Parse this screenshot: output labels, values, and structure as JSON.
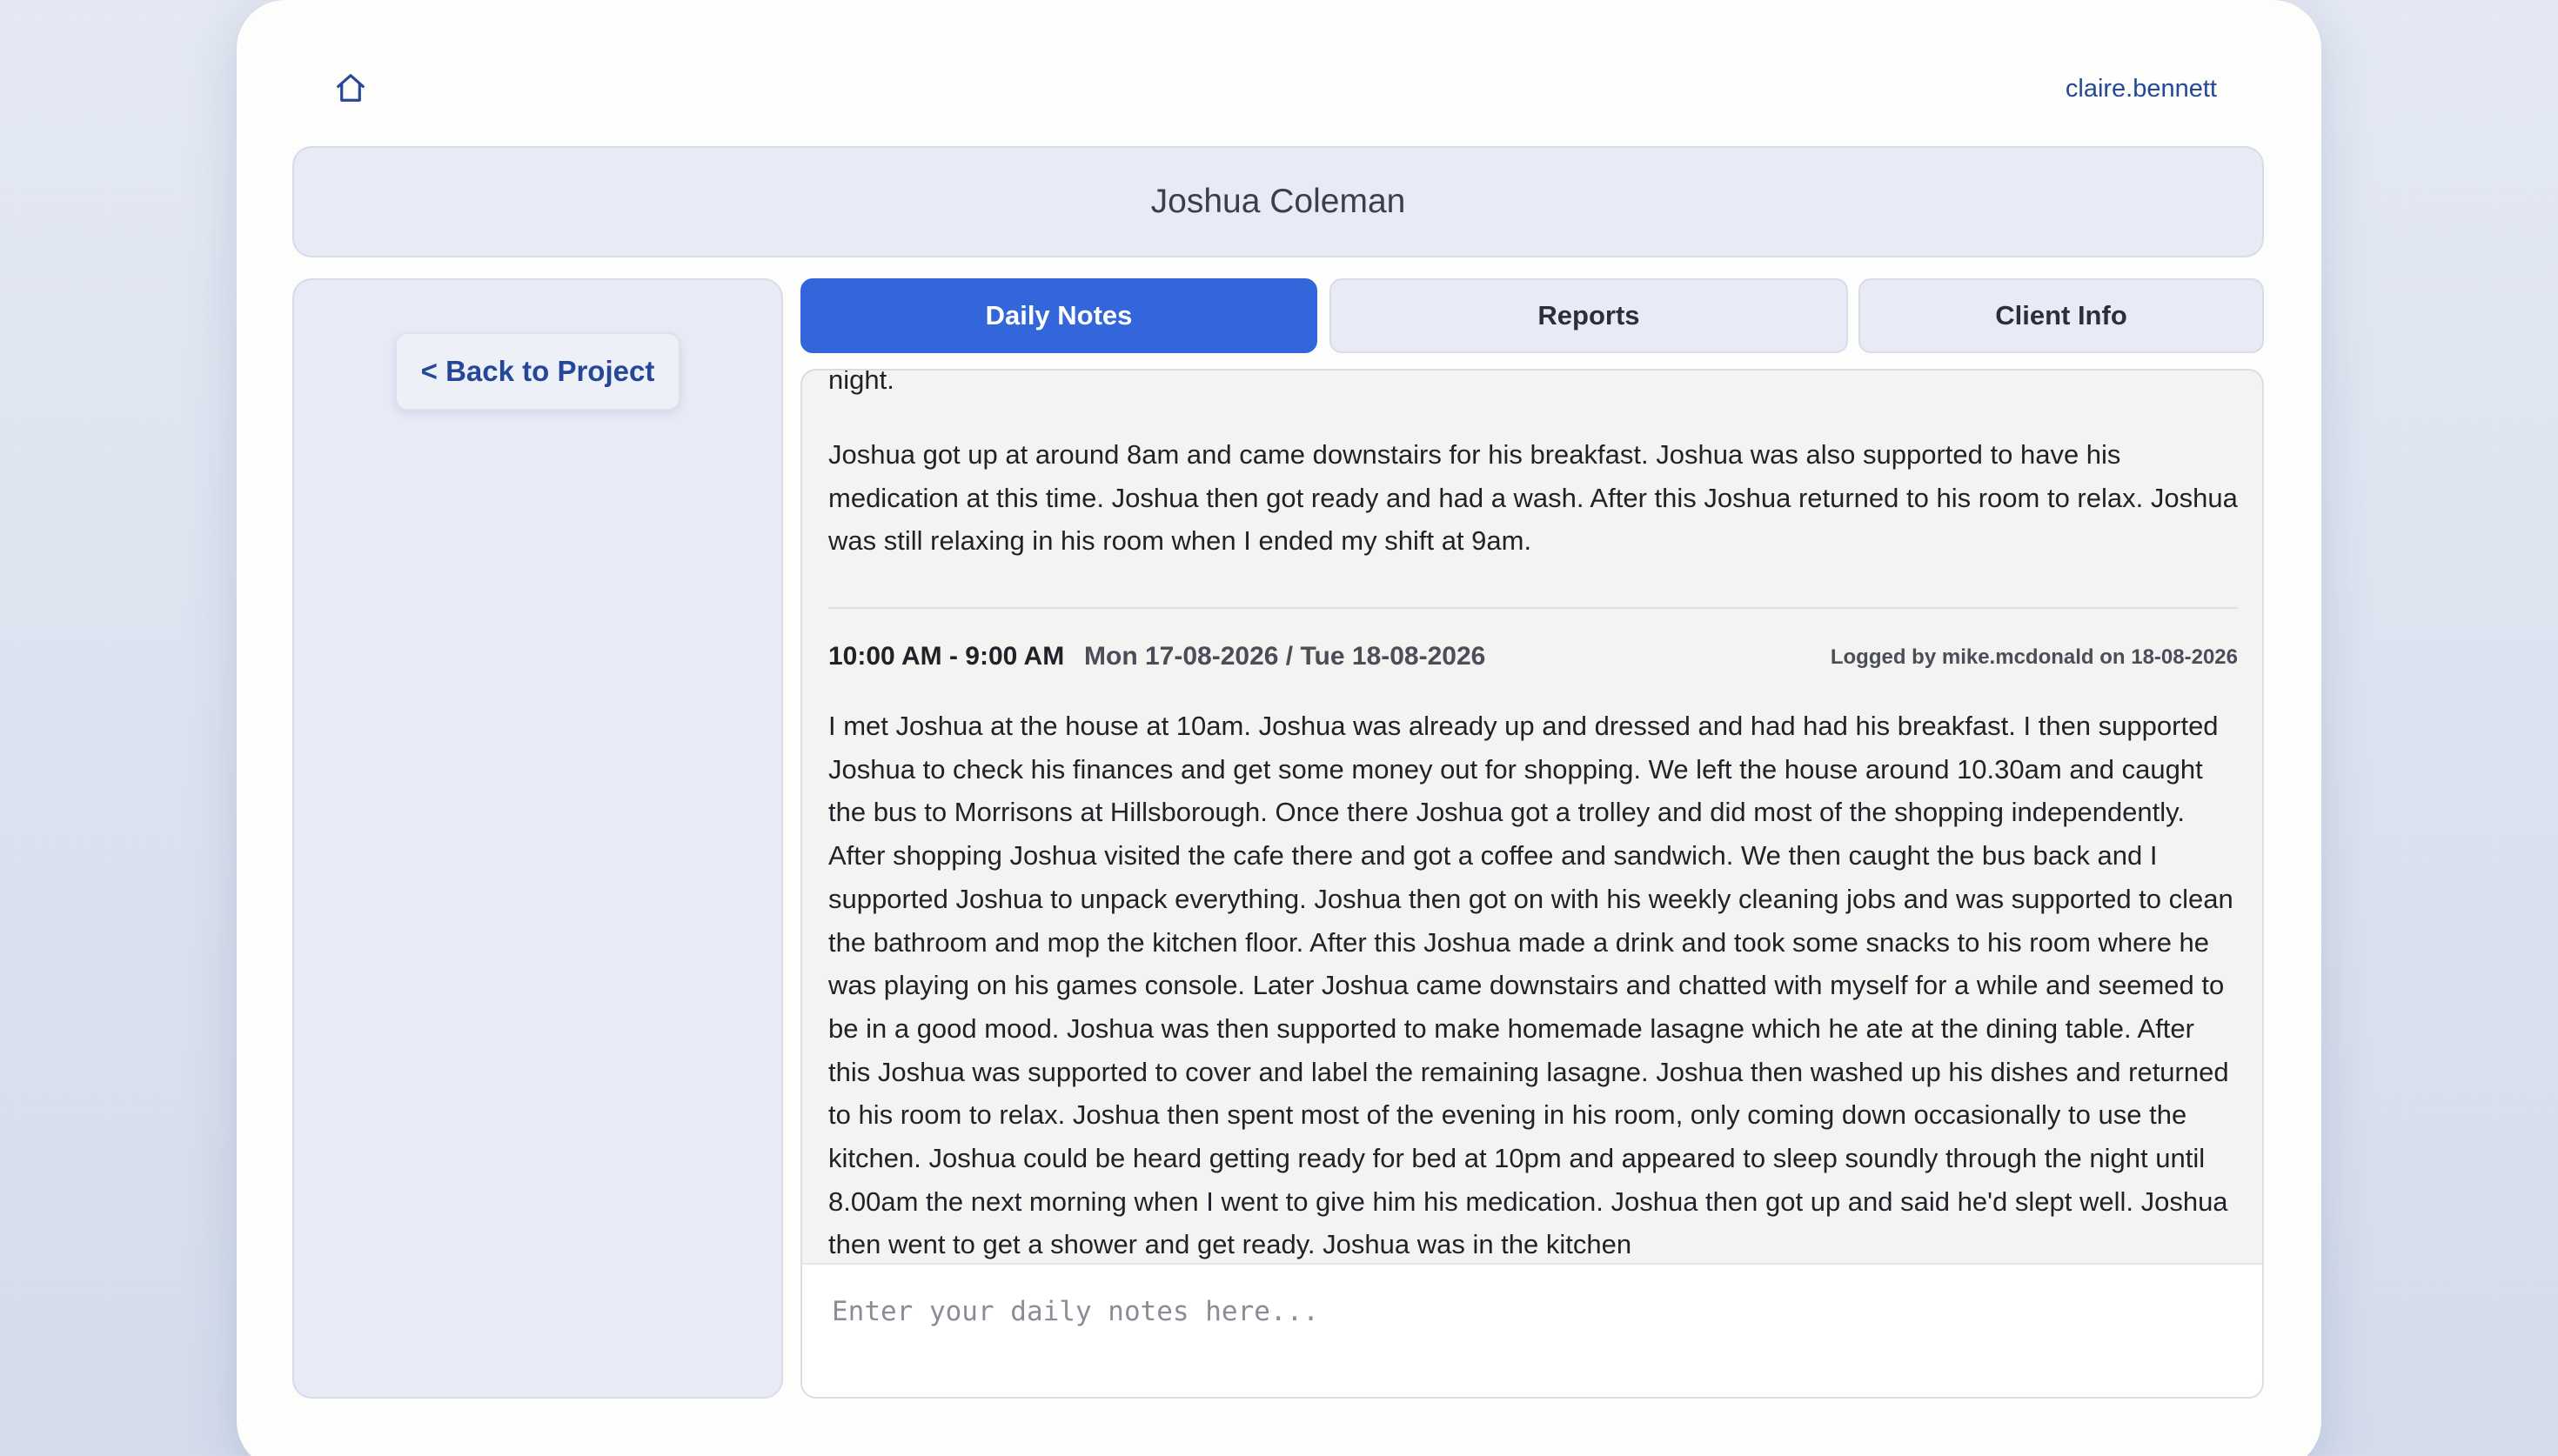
{
  "header": {
    "username": "claire.bennett"
  },
  "client": {
    "name": "Joshua Coleman"
  },
  "sidebar": {
    "back_label": "< Back to Project"
  },
  "tabs": [
    {
      "label": "Daily Notes",
      "active": true
    },
    {
      "label": "Reports",
      "active": false
    },
    {
      "label": "Client Info",
      "active": false
    }
  ],
  "notes": {
    "partial_top": "night.",
    "first_body": "Joshua got up at around 8am and came downstairs for his breakfast. Joshua was also supported to have his medication at this time. Joshua then got ready and had a wash. After this Joshua returned to his room to relax. Joshua was still relaxing in his room when I ended my shift at 9am.",
    "second": {
      "time": "10:00 AM - 9:00 AM",
      "dates": "Mon 17-08-2026 / Tue 18-08-2026",
      "logged": "Logged by mike.mcdonald on 18-08-2026",
      "body": "I met Joshua at the house at 10am. Joshua was already up and dressed and had had his breakfast. I then supported Joshua to check his finances and get some money out for shopping. We left the house around 10.30am and caught the bus to Morrisons at Hillsborough. Once there Joshua got a trolley and did most of the shopping independently. After shopping Joshua visited the cafe there and got a coffee and sandwich. We then caught the bus back and I supported Joshua to unpack everything. Joshua then got on with his weekly cleaning jobs and was supported to clean the bathroom and mop the kitchen floor. After this Joshua made a drink and took some snacks to his room where he was playing on his games console. Later Joshua came downstairs and chatted with myself for a while and seemed to be in a good mood. Joshua was then supported to make homemade lasagne which he ate at the dining table. After this Joshua was supported to cover and label the remaining lasagne. Joshua then washed up his dishes and returned to his room to relax. Joshua then spent most of the evening in his room, only coming down occasionally to use the kitchen. Joshua could be heard getting ready for bed at 10pm and appeared to sleep soundly through the night until 8.00am the next morning when I went to give him his medication. Joshua then got up and said he'd slept well. Joshua then went to get a shower and get ready. Joshua was in the kitchen"
    },
    "input_placeholder": "Enter your daily notes here..."
  },
  "colors": {
    "accent": "#3466db",
    "link": "#24479a",
    "panel": "#e8ebf5"
  }
}
